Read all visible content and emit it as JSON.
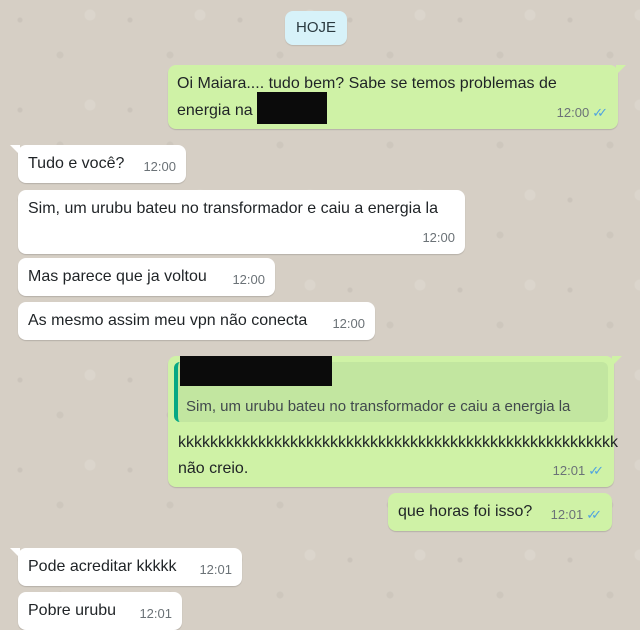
{
  "date_separator": "HOJE",
  "messages": [
    {
      "direction": "out",
      "line1": "Oi Maiara.... tudo bem? Sabe se temos problemas de",
      "line2": "energia na",
      "time": "12:00"
    },
    {
      "direction": "in",
      "text": "Tudo e você?",
      "time": "12:00"
    },
    {
      "direction": "in",
      "text": "Sim, um urubu bateu no transformador e caiu a energia la",
      "time": "12:00"
    },
    {
      "direction": "in",
      "text": "Mas parece que ja voltou",
      "time": "12:00"
    },
    {
      "direction": "in",
      "text": "As mesmo assim meu vpn não conecta",
      "time": "12:00"
    },
    {
      "direction": "out",
      "quoted_text": "Sim, um urubu bateu no transformador e caiu a energia la",
      "line1": "kkkkkkkkkkkkkkkkkkkkkkkkkkkkkkkkkkkkkkkkkkkkkkkkkkkkkkk",
      "line2": "não creio.",
      "time": "12:01"
    },
    {
      "direction": "out",
      "text": "que horas foi isso?",
      "time": "12:01"
    },
    {
      "direction": "in",
      "text": "Pode acreditar kkkkk",
      "time": "12:01"
    },
    {
      "direction": "in",
      "text": "Pobre urubu",
      "time": "12:01"
    }
  ],
  "colors": {
    "incoming": "#ffffff",
    "outgoing": "#cff2a6",
    "read_ticks": "#4fa3e0",
    "quote_bar": "#06a884"
  },
  "icons": {
    "read_receipt": "double-check-icon"
  }
}
